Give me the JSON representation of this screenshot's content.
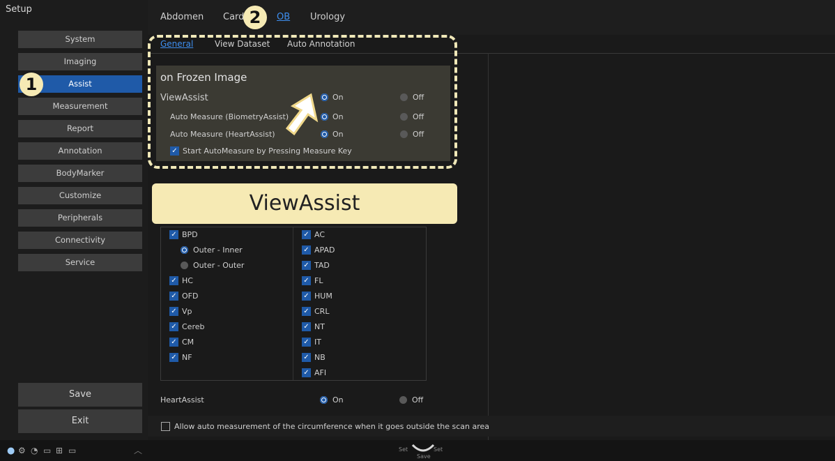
{
  "sidebar": {
    "title": "Setup",
    "items": [
      {
        "label": "System"
      },
      {
        "label": "Imaging"
      },
      {
        "label": "Assist"
      },
      {
        "label": "Measurement"
      },
      {
        "label": "Report"
      },
      {
        "label": "Annotation"
      },
      {
        "label": "BodyMarker"
      },
      {
        "label": "Customize"
      },
      {
        "label": "Peripherals"
      },
      {
        "label": "Connectivity"
      },
      {
        "label": "Service"
      }
    ],
    "save_label": "Save",
    "exit_label": "Exit"
  },
  "top_tabs": [
    {
      "label": "Abdomen"
    },
    {
      "label": "Card"
    },
    {
      "label": "OB"
    },
    {
      "label": "Urology"
    }
  ],
  "sub_tabs": [
    {
      "label": "General"
    },
    {
      "label": "View Dataset"
    },
    {
      "label": "Auto Annotation"
    }
  ],
  "frozen": {
    "title": "on Frozen Image",
    "rows": [
      {
        "label": "ViewAssist",
        "on": "On",
        "off": "Off"
      },
      {
        "label": "Auto Measure (BiometryAssist)",
        "on": "On",
        "off": "Off"
      },
      {
        "label": "Auto Measure (HeartAssist)",
        "on": "On",
        "off": "Off"
      }
    ],
    "checkbox_label": "Start AutoMeasure by Pressing Measure Key"
  },
  "banner": "ViewAssist",
  "badges": {
    "one": "1",
    "two": "2"
  },
  "grid": {
    "left": [
      {
        "label": "BPD",
        "type": "check"
      },
      {
        "label": "Outer - Inner",
        "type": "radio-on"
      },
      {
        "label": "Outer - Outer",
        "type": "radio-off"
      },
      {
        "label": "HC",
        "type": "check"
      },
      {
        "label": "OFD",
        "type": "check"
      },
      {
        "label": "Vp",
        "type": "check"
      },
      {
        "label": "Cereb",
        "type": "check"
      },
      {
        "label": "CM",
        "type": "check"
      },
      {
        "label": "NF",
        "type": "check"
      }
    ],
    "right": [
      {
        "label": "AC"
      },
      {
        "label": "APAD"
      },
      {
        "label": "TAD"
      },
      {
        "label": "FL"
      },
      {
        "label": "HUM"
      },
      {
        "label": "CRL"
      },
      {
        "label": "NT"
      },
      {
        "label": "IT"
      },
      {
        "label": "NB"
      },
      {
        "label": "AFI"
      }
    ]
  },
  "heart": {
    "label": "HeartAssist",
    "on": "On",
    "off": "Off"
  },
  "allow_label": "Allow auto measurement of the circumference when it goes outside the scan area",
  "bottom": {
    "set_left": "Set",
    "set_right": "Set",
    "save": "Save"
  },
  "colors": {
    "accent": "#1f5aa8",
    "highlight": "#f6eab4"
  }
}
